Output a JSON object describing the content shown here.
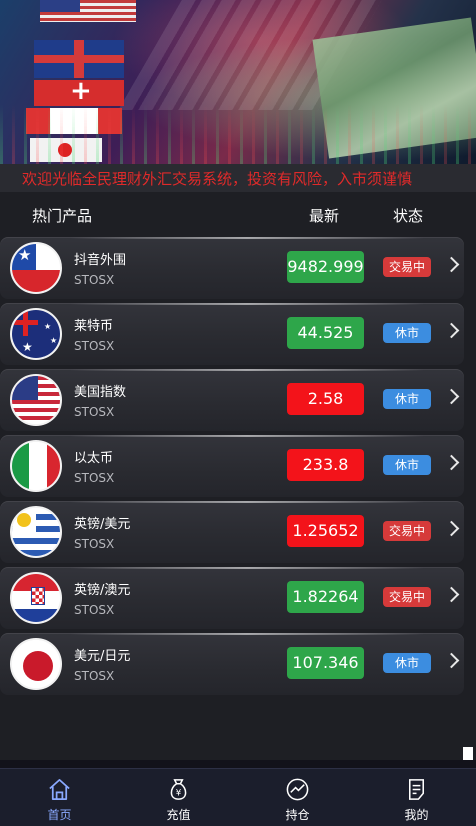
{
  "notice": "欢迎光临全民理财外汇交易系统，投资有风险，入市须谨慎",
  "table_header": {
    "name": "热门产品",
    "price": "最新",
    "status": "状态"
  },
  "products": [
    {
      "name": "抖音外围",
      "code": "STOSX",
      "price": "9482.999",
      "trend": "up",
      "status": "交易中",
      "status_type": "open",
      "flag": "chile"
    },
    {
      "name": "莱特币",
      "code": "STOSX",
      "price": "44.525",
      "trend": "up",
      "status": "休市",
      "status_type": "closed",
      "flag": "australia"
    },
    {
      "name": "美国指数",
      "code": "STOSX",
      "price": "2.58",
      "trend": "down",
      "status": "休市",
      "status_type": "closed",
      "flag": "usa"
    },
    {
      "name": "以太币",
      "code": "STOSX",
      "price": "233.8",
      "trend": "down",
      "status": "休市",
      "status_type": "closed",
      "flag": "italy"
    },
    {
      "name": "英镑/美元",
      "code": "STOSX",
      "price": "1.25652",
      "trend": "down",
      "status": "交易中",
      "status_type": "open",
      "flag": "uruguay"
    },
    {
      "name": "英镑/澳元",
      "code": "STOSX",
      "price": "1.82264",
      "trend": "up",
      "status": "交易中",
      "status_type": "open",
      "flag": "croatia"
    },
    {
      "name": "美元/日元",
      "code": "STOSX",
      "price": "107.346",
      "trend": "up",
      "status": "休市",
      "status_type": "closed",
      "flag": "japan"
    }
  ],
  "tabs": [
    {
      "label": "首页",
      "icon": "home-icon",
      "active": true
    },
    {
      "label": "充值",
      "icon": "money-bag-icon",
      "active": false
    },
    {
      "label": "持仓",
      "icon": "chart-icon",
      "active": false
    },
    {
      "label": "我的",
      "icon": "profile-icon",
      "active": false
    }
  ],
  "colors": {
    "up": "#2ea64a",
    "down": "#f3131a",
    "open_badge": "#d63a3a",
    "closed_badge": "#3c8de0",
    "notice": "#e02a2a",
    "active_tab": "#8aa9ff"
  }
}
